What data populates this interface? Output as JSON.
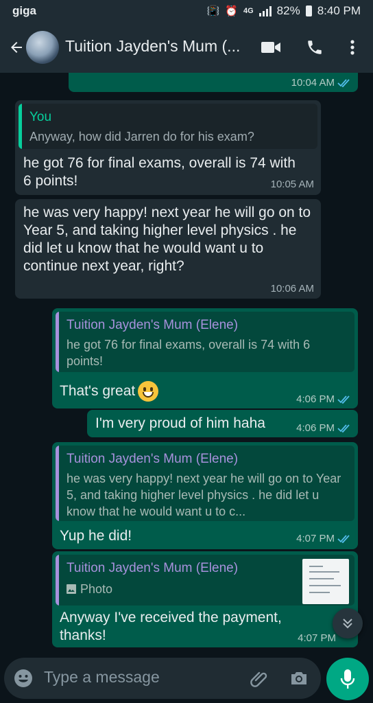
{
  "status_bar": {
    "carrier": "giga",
    "battery": "82%",
    "time": "8:40 PM"
  },
  "header": {
    "title": "Tuition Jayden's Mum (..."
  },
  "messages": [
    {
      "time": "10:04 AM"
    },
    {
      "quote_author": "You",
      "quote_text": "Anyway, how did Jarren do for his exam?",
      "text": "he got 76 for final exams, overall is 74 with 6 points!",
      "time": "10:05 AM"
    },
    {
      "text": "he was very happy! next year he will go on to Year 5, and taking higher level physics . he did let u know that he would want u to continue next year, right?",
      "time": "10:06 AM"
    },
    {
      "quote_author": "Tuition Jayden's Mum (Elene)",
      "quote_text": "he got 76 for final exams, overall is 74 with 6 points!",
      "text": "That's great",
      "time": "4:06 PM"
    },
    {
      "text": "I'm very proud of him haha",
      "time": "4:06 PM"
    },
    {
      "quote_author": "Tuition Jayden's Mum (Elene)",
      "quote_text": "he was very happy! next year he will go on to Year 5, and taking higher level physics . he did let u know that he would want u to c...",
      "text": "Yup he did!",
      "time": "4:07 PM"
    },
    {
      "quote_author": "Tuition Jayden's Mum (Elene)",
      "quote_text": "Photo",
      "text": "Anyway I've received the payment, thanks!",
      "time": "4:07 PM"
    }
  ],
  "composer": {
    "placeholder": "Type a message"
  },
  "colors": {
    "incoming": "#202c33",
    "outgoing": "#005c4b",
    "accent": "#00a884",
    "quote_you": "#06cf9c",
    "quote_contact": "#a791dc",
    "ticks": "#53bdeb"
  }
}
